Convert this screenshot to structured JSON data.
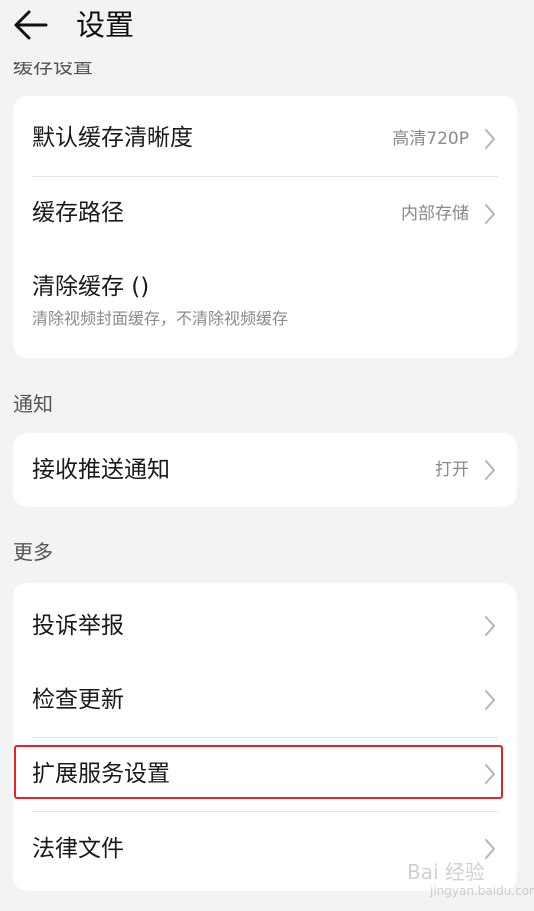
{
  "header": {
    "title": "设置"
  },
  "sections": {
    "cache": {
      "label": "缓存设置"
    },
    "notify": {
      "label": "通知"
    },
    "more": {
      "label": "更多"
    }
  },
  "cache_card": {
    "default_quality": {
      "label": "默认缓存清晰度",
      "value": "高清720P"
    },
    "cache_path": {
      "label": "缓存路径",
      "value": "内部存储"
    },
    "clear_cache": {
      "label": "清除缓存 ()",
      "sub": "清除视频封面缓存，不清除视频缓存"
    }
  },
  "notify_card": {
    "push": {
      "label": "接收推送通知",
      "value": "打开"
    }
  },
  "more_card": {
    "report": {
      "label": "投诉举报"
    },
    "update": {
      "label": "检查更新"
    },
    "extension": {
      "label": "扩展服务设置"
    },
    "legal": {
      "label": "法律文件"
    }
  },
  "watermark": {
    "text": "Bai 经验",
    "sub": "jingyan.baidu.com"
  },
  "colors": {
    "background": "#f1f3f5",
    "card": "#ffffff",
    "highlight": "#e8202a",
    "secondary_text": "#8a8a8a"
  },
  "icons": {
    "back": "arrow-left-icon",
    "chevron": "chevron-right-icon"
  }
}
